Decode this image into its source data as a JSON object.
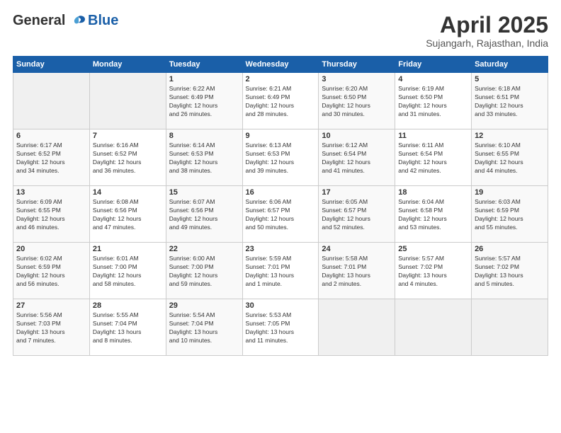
{
  "header": {
    "logo_line1": "General",
    "logo_line2": "Blue",
    "title": "April 2025",
    "location": "Sujangarh, Rajasthan, India"
  },
  "weekdays": [
    "Sunday",
    "Monday",
    "Tuesday",
    "Wednesday",
    "Thursday",
    "Friday",
    "Saturday"
  ],
  "weeks": [
    [
      {
        "day": "",
        "info": ""
      },
      {
        "day": "",
        "info": ""
      },
      {
        "day": "1",
        "info": "Sunrise: 6:22 AM\nSunset: 6:49 PM\nDaylight: 12 hours\nand 26 minutes."
      },
      {
        "day": "2",
        "info": "Sunrise: 6:21 AM\nSunset: 6:49 PM\nDaylight: 12 hours\nand 28 minutes."
      },
      {
        "day": "3",
        "info": "Sunrise: 6:20 AM\nSunset: 6:50 PM\nDaylight: 12 hours\nand 30 minutes."
      },
      {
        "day": "4",
        "info": "Sunrise: 6:19 AM\nSunset: 6:50 PM\nDaylight: 12 hours\nand 31 minutes."
      },
      {
        "day": "5",
        "info": "Sunrise: 6:18 AM\nSunset: 6:51 PM\nDaylight: 12 hours\nand 33 minutes."
      }
    ],
    [
      {
        "day": "6",
        "info": "Sunrise: 6:17 AM\nSunset: 6:52 PM\nDaylight: 12 hours\nand 34 minutes."
      },
      {
        "day": "7",
        "info": "Sunrise: 6:16 AM\nSunset: 6:52 PM\nDaylight: 12 hours\nand 36 minutes."
      },
      {
        "day": "8",
        "info": "Sunrise: 6:14 AM\nSunset: 6:53 PM\nDaylight: 12 hours\nand 38 minutes."
      },
      {
        "day": "9",
        "info": "Sunrise: 6:13 AM\nSunset: 6:53 PM\nDaylight: 12 hours\nand 39 minutes."
      },
      {
        "day": "10",
        "info": "Sunrise: 6:12 AM\nSunset: 6:54 PM\nDaylight: 12 hours\nand 41 minutes."
      },
      {
        "day": "11",
        "info": "Sunrise: 6:11 AM\nSunset: 6:54 PM\nDaylight: 12 hours\nand 42 minutes."
      },
      {
        "day": "12",
        "info": "Sunrise: 6:10 AM\nSunset: 6:55 PM\nDaylight: 12 hours\nand 44 minutes."
      }
    ],
    [
      {
        "day": "13",
        "info": "Sunrise: 6:09 AM\nSunset: 6:55 PM\nDaylight: 12 hours\nand 46 minutes."
      },
      {
        "day": "14",
        "info": "Sunrise: 6:08 AM\nSunset: 6:56 PM\nDaylight: 12 hours\nand 47 minutes."
      },
      {
        "day": "15",
        "info": "Sunrise: 6:07 AM\nSunset: 6:56 PM\nDaylight: 12 hours\nand 49 minutes."
      },
      {
        "day": "16",
        "info": "Sunrise: 6:06 AM\nSunset: 6:57 PM\nDaylight: 12 hours\nand 50 minutes."
      },
      {
        "day": "17",
        "info": "Sunrise: 6:05 AM\nSunset: 6:57 PM\nDaylight: 12 hours\nand 52 minutes."
      },
      {
        "day": "18",
        "info": "Sunrise: 6:04 AM\nSunset: 6:58 PM\nDaylight: 12 hours\nand 53 minutes."
      },
      {
        "day": "19",
        "info": "Sunrise: 6:03 AM\nSunset: 6:59 PM\nDaylight: 12 hours\nand 55 minutes."
      }
    ],
    [
      {
        "day": "20",
        "info": "Sunrise: 6:02 AM\nSunset: 6:59 PM\nDaylight: 12 hours\nand 56 minutes."
      },
      {
        "day": "21",
        "info": "Sunrise: 6:01 AM\nSunset: 7:00 PM\nDaylight: 12 hours\nand 58 minutes."
      },
      {
        "day": "22",
        "info": "Sunrise: 6:00 AM\nSunset: 7:00 PM\nDaylight: 12 hours\nand 59 minutes."
      },
      {
        "day": "23",
        "info": "Sunrise: 5:59 AM\nSunset: 7:01 PM\nDaylight: 13 hours\nand 1 minute."
      },
      {
        "day": "24",
        "info": "Sunrise: 5:58 AM\nSunset: 7:01 PM\nDaylight: 13 hours\nand 2 minutes."
      },
      {
        "day": "25",
        "info": "Sunrise: 5:57 AM\nSunset: 7:02 PM\nDaylight: 13 hours\nand 4 minutes."
      },
      {
        "day": "26",
        "info": "Sunrise: 5:57 AM\nSunset: 7:02 PM\nDaylight: 13 hours\nand 5 minutes."
      }
    ],
    [
      {
        "day": "27",
        "info": "Sunrise: 5:56 AM\nSunset: 7:03 PM\nDaylight: 13 hours\nand 7 minutes."
      },
      {
        "day": "28",
        "info": "Sunrise: 5:55 AM\nSunset: 7:04 PM\nDaylight: 13 hours\nand 8 minutes."
      },
      {
        "day": "29",
        "info": "Sunrise: 5:54 AM\nSunset: 7:04 PM\nDaylight: 13 hours\nand 10 minutes."
      },
      {
        "day": "30",
        "info": "Sunrise: 5:53 AM\nSunset: 7:05 PM\nDaylight: 13 hours\nand 11 minutes."
      },
      {
        "day": "",
        "info": ""
      },
      {
        "day": "",
        "info": ""
      },
      {
        "day": "",
        "info": ""
      }
    ]
  ]
}
